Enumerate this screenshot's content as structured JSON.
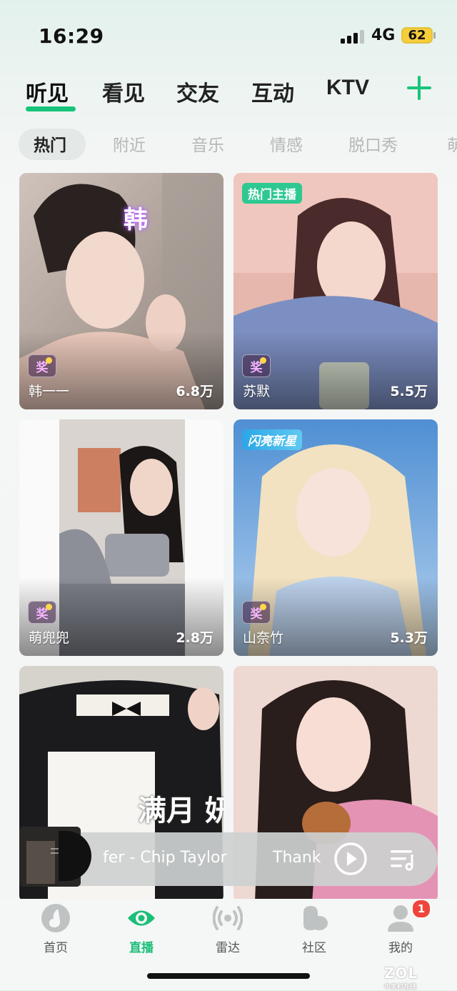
{
  "status": {
    "time": "16:29",
    "network": "4G",
    "battery": "62"
  },
  "main_tabs": [
    "听见",
    "看见",
    "交友",
    "互动",
    "KTV"
  ],
  "sub_tabs": [
    "热门",
    "附近",
    "音乐",
    "情感",
    "脱口秀",
    "萌"
  ],
  "cards": [
    {
      "name": "韩一一",
      "count": "6.8万",
      "tag": "",
      "award": "奖",
      "overlay_text": "韩"
    },
    {
      "name": "苏默",
      "count": "5.5万",
      "tag": "热门主播",
      "award": "奖"
    },
    {
      "name": "萌兜兜",
      "count": "2.8万",
      "tag": "",
      "award": "奖"
    },
    {
      "name": "山奈竹",
      "count": "5.3万",
      "tag": "闪亮新星",
      "award": "奖"
    },
    {
      "name": "",
      "count": "",
      "tag": "",
      "award": "",
      "overlay_text": "满月 妍"
    },
    {
      "name": "",
      "count": "",
      "tag": "",
      "award": ""
    }
  ],
  "player": {
    "song": "fer - Chip Taylor",
    "next": "Thank"
  },
  "bottom_nav": [
    {
      "label": "首页",
      "icon": "music-note-icon"
    },
    {
      "label": "直播",
      "icon": "eye-icon"
    },
    {
      "label": "雷达",
      "icon": "radar-icon"
    },
    {
      "label": "社区",
      "icon": "community-icon"
    },
    {
      "label": "我的",
      "icon": "profile-icon"
    }
  ],
  "notification_count": "1",
  "watermark": {
    "text": "ZOL",
    "sub": "中关村在线"
  },
  "colors": {
    "accent": "#18c47a",
    "tag_green": "#2ec892",
    "tag_blue": "#2ba6e8",
    "badge_red": "#f0453d"
  }
}
